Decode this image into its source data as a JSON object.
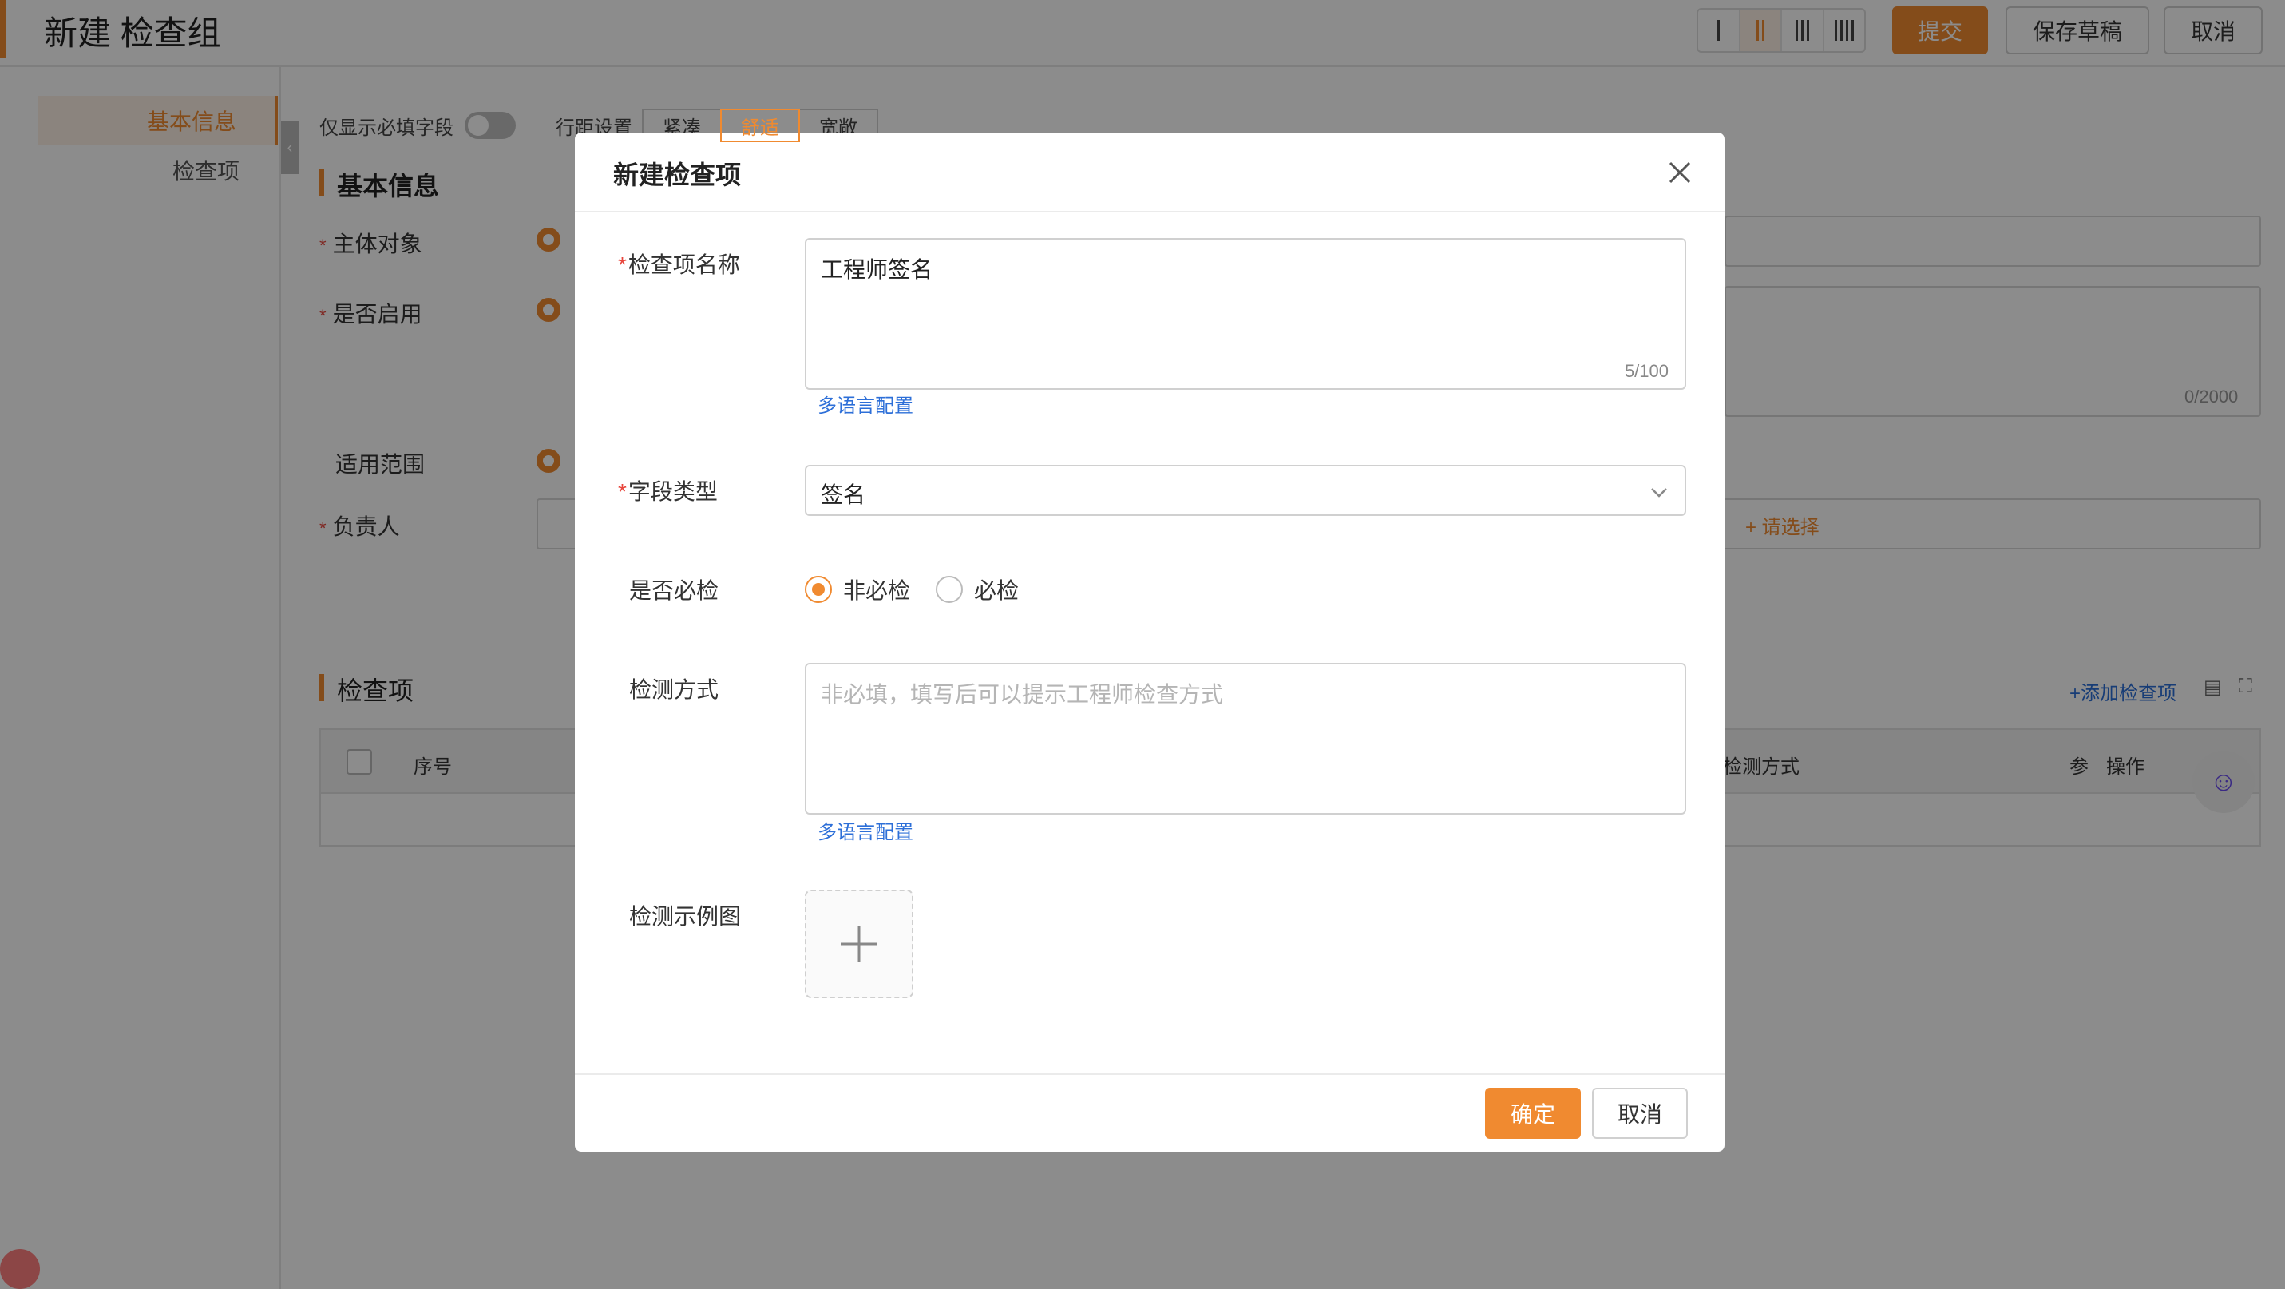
{
  "page": {
    "title": "新建 检查组",
    "toolbar": {
      "submit_label": "提交",
      "save_draft_label": "保存草稿",
      "cancel_label": "取消"
    }
  },
  "sidebar": {
    "items": [
      {
        "label": "基本信息",
        "active": true
      },
      {
        "label": "检查项",
        "active": false
      }
    ]
  },
  "form_options": {
    "required_only_label": "仅显示必填字段",
    "spacing_label": "行距设置",
    "spacing_options": [
      "紧凑",
      "舒适",
      "宽敞"
    ],
    "spacing_selected": "舒适"
  },
  "basic_info": {
    "section_title": "基本信息",
    "fields": [
      {
        "label": "主体对象",
        "required": true
      },
      {
        "label": "是否启用",
        "required": true
      },
      {
        "label": "适用范围",
        "required": false
      },
      {
        "label": "负责人",
        "required": true
      }
    ],
    "counter": "0/2000",
    "select_placeholder": "+ 请选择"
  },
  "check_items": {
    "section_title": "检查项",
    "add_label": "+添加检查项",
    "columns": [
      "序号",
      "检测方式",
      "参",
      "操作"
    ]
  },
  "modal": {
    "title": "新建检查项",
    "name_field": {
      "label": "检查项名称",
      "value": "工程师签名",
      "counter": "5/100",
      "i18n_link": "多语言配置"
    },
    "type_field": {
      "label": "字段类型",
      "value": "签名"
    },
    "required_field": {
      "label": "是否必检",
      "options": [
        "非必检",
        "必检"
      ],
      "selected": "非必检"
    },
    "method_field": {
      "label": "检测方式",
      "placeholder": "非必填，填写后可以提示工程师检查方式",
      "i18n_link": "多语言配置"
    },
    "image_field": {
      "label": "检测示例图"
    },
    "ok_label": "确定",
    "cancel_label": "取消"
  },
  "colors": {
    "accent": "#f08a30",
    "link": "#2d6fd8",
    "required_star": "#e8453c"
  }
}
